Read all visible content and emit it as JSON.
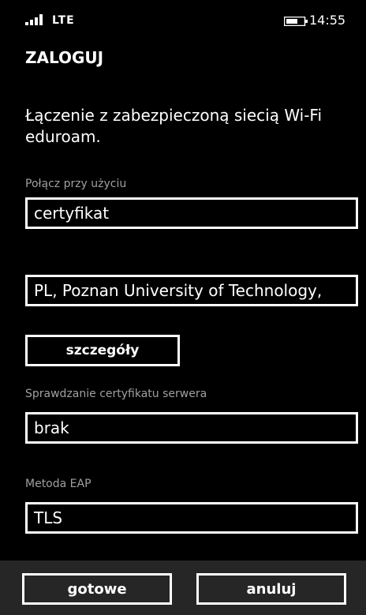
{
  "status_bar": {
    "network": "LTE",
    "time": "14:55",
    "icons": [
      "signal-strength-icon",
      "battery-icon"
    ]
  },
  "page": {
    "title": "ZALOGUJ",
    "description": "Łączenie z zabezpieczoną siecią Wi-Fi eduroam."
  },
  "connect_using": {
    "label": "Połącz przy użyciu",
    "value": "certyfikat"
  },
  "certificate": {
    "value": "PL, Poznan University of Technology,"
  },
  "details_button": {
    "label": "szczegóły"
  },
  "server_cert_check": {
    "label": "Sprawdzanie certyfikatu serwera",
    "value": "brak"
  },
  "eap_method": {
    "label": "Metoda EAP",
    "value": "TLS"
  },
  "app_bar": {
    "done_label": "gotowe",
    "cancel_label": "anuluj",
    "background": "#262626"
  }
}
